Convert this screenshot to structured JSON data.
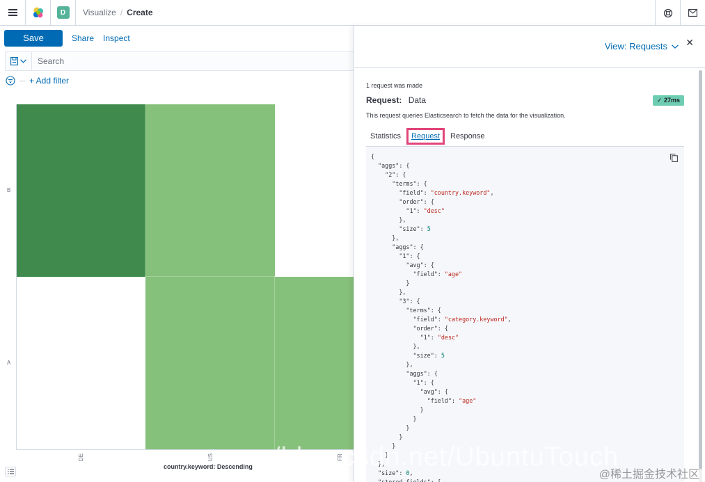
{
  "header": {
    "space_initial": "D",
    "breadcrumbs": [
      "Visualize",
      "Create"
    ]
  },
  "toolbar": {
    "save_label": "Save",
    "share_label": "Share",
    "inspect_label": "Inspect"
  },
  "query": {
    "search_placeholder": "Search",
    "add_filter_label": "+ Add filter"
  },
  "chart_data": {
    "type": "heatmap",
    "x_categories": [
      "DE",
      "US",
      "FR"
    ],
    "y_categories": [
      "B",
      "A"
    ],
    "xlabel": "country.keyword: Descending",
    "colors": {
      "dark": "#3f8a4c",
      "light": "#86c17b",
      "empty": "#ffffff"
    },
    "cells": [
      {
        "x": "DE",
        "y": "B",
        "level": "dark"
      },
      {
        "x": "US",
        "y": "B",
        "level": "light"
      },
      {
        "x": "FR",
        "y": "B",
        "level": "empty"
      },
      {
        "x": "DE",
        "y": "A",
        "level": "empty"
      },
      {
        "x": "US",
        "y": "A",
        "level": "light"
      },
      {
        "x": "FR",
        "y": "A",
        "level": "light"
      }
    ]
  },
  "inspector": {
    "view_label": "View: Requests",
    "request_count_text": "1 request was made",
    "request_label": "Request:",
    "request_name": "Data",
    "duration_badge": "27ms",
    "description": "This request queries Elasticsearch to fetch the data for the visualization.",
    "tabs": [
      {
        "label": "Statistics",
        "active": false
      },
      {
        "label": "Request",
        "active": true
      },
      {
        "label": "Response",
        "active": false
      }
    ],
    "code_lines": [
      "{",
      "  \"aggs\": {",
      "    \"2\": {",
      "      \"terms\": {",
      "        \"field\": \"country.keyword\",",
      "        \"order\": {",
      "          \"1\": \"desc\"",
      "        },",
      "        \"size\": 5",
      "      },",
      "      \"aggs\": {",
      "        \"1\": {",
      "          \"avg\": {",
      "            \"field\": \"age\"",
      "          }",
      "        },",
      "        \"3\": {",
      "          \"terms\": {",
      "            \"field\": \"category.keyword\",",
      "            \"order\": {",
      "              \"1\": \"desc\"",
      "            },",
      "            \"size\": 5",
      "          },",
      "          \"aggs\": {",
      "            \"1\": {",
      "              \"avg\": {",
      "                \"field\": \"age\"",
      "              }",
      "            }",
      "          }",
      "        }",
      "      }",
      "    }",
      "  },",
      "  \"size\": 0,",
      "  \"stored_fields\": ["
    ]
  },
  "watermarks": {
    "overlay": "/blog.csdn.net/UbuntuTouch",
    "corner": "@稀土掘金技术社区"
  }
}
